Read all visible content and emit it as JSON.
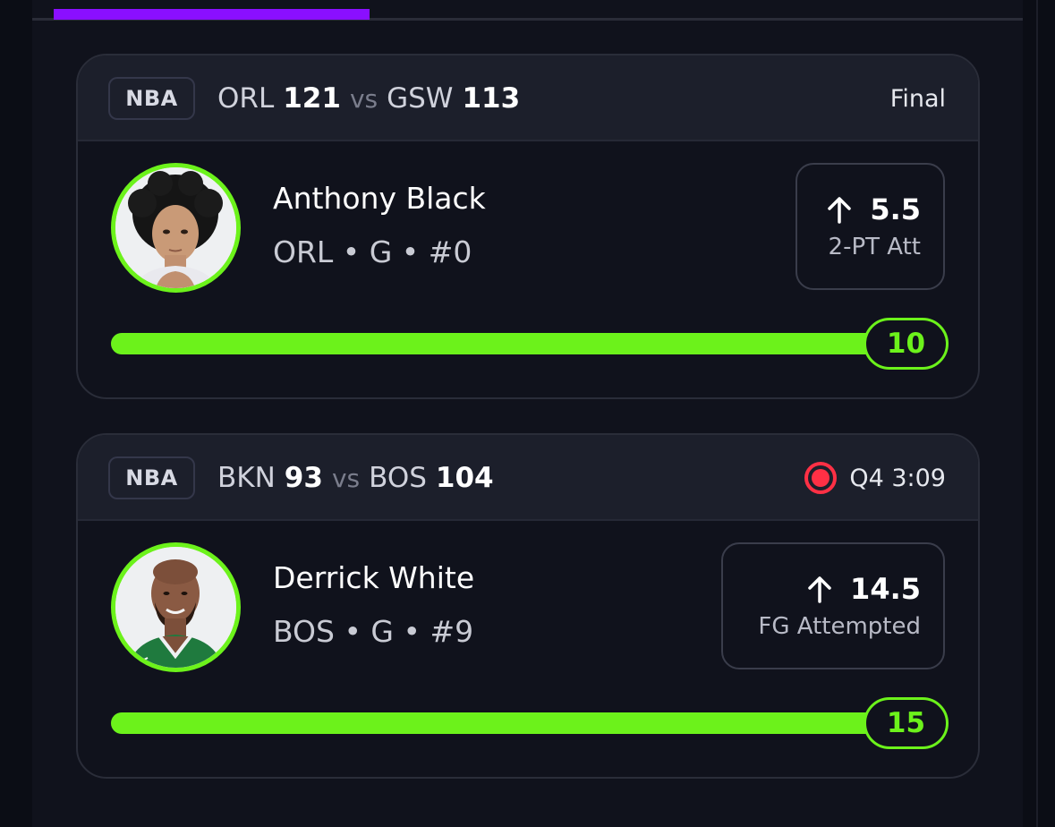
{
  "cards": [
    {
      "league": "NBA",
      "home_team": "ORL",
      "home_score": "121",
      "vs": "vs",
      "away_team": "GSW",
      "away_score": "113",
      "status": "Final",
      "live": false,
      "player_name": "Anthony Black",
      "player_meta": "ORL • G • #0",
      "line_direction": "up",
      "line_value": "5.5",
      "line_stat": "2-PT Att",
      "progress_value": "10",
      "progress_fraction": 1.0
    },
    {
      "league": "NBA",
      "home_team": "BKN",
      "home_score": "93",
      "vs": "vs",
      "away_team": "BOS",
      "away_score": "104",
      "status": "Q4 3:09",
      "live": true,
      "player_name": "Derrick White",
      "player_meta": "BOS • G • #9",
      "line_direction": "up",
      "line_value": "14.5",
      "line_stat": "FG Attempted",
      "progress_value": "15",
      "progress_fraction": 1.0
    }
  ],
  "colors": {
    "accent_green": "#6cf21b",
    "tab_indicator": "#8a0fff",
    "live_red": "#ff3045"
  },
  "icons": {
    "live": "live-indicator-icon",
    "direction": "arrow-up-icon"
  }
}
